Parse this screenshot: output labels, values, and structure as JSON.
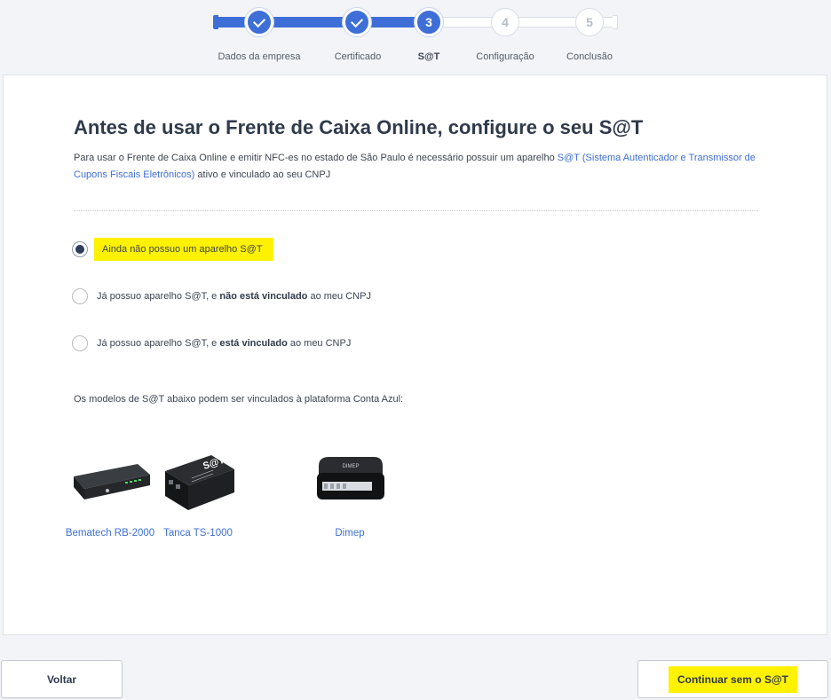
{
  "stepper": {
    "steps": [
      {
        "number": "1",
        "label": "Dados da empresa",
        "status": "done"
      },
      {
        "number": "2",
        "label": "Certificado",
        "status": "done"
      },
      {
        "number": "3",
        "label": "S@T",
        "status": "active"
      },
      {
        "number": "4",
        "label": "Configuração",
        "status": "todo"
      },
      {
        "number": "5",
        "label": "Conclusão",
        "status": "todo"
      }
    ]
  },
  "main": {
    "title": "Antes de usar o Frente de Caixa Online, configure o seu S@T",
    "intro_text": "Para usar o Frente de Caixa Online e emitir NFC-es no estado de São Paulo é necessário possuir um aparelho",
    "intro_link": "S@T (Sistema Autenticador e Transmissor de Cupons Fiscais Eletrônicos)",
    "intro_suffix": "ativo e vinculado ao seu CNPJ",
    "options": [
      {
        "label": "Ainda não possuo um aparelho S@T",
        "checked": true
      },
      {
        "prefix": "Já possuo aparelho S@T, e",
        "bold": "não está vinculado",
        "suffix": "ao meu CNPJ",
        "checked": false
      },
      {
        "prefix": "Já possuo aparelho S@T, e",
        "bold": "está vinculado",
        "suffix": "ao meu CNPJ",
        "checked": false
      }
    ],
    "models_text": "Os modelos de S@T abaixo podem ser vinculados à plataforma Conta Azul:",
    "products": [
      {
        "name": "Bematech RB-2000",
        "icon": "bematech-device-image"
      },
      {
        "name": "Tanca TS-1000",
        "icon": "tanca-device-image",
        "device_text": "S@T"
      },
      {
        "name": "Dimep",
        "icon": "dimep-device-image",
        "device_text": "DIMEP"
      }
    ]
  },
  "footer": {
    "back_label": "Voltar",
    "next_label": "Continuar sem o S@T"
  },
  "colors": {
    "accent": "#3e6fd7",
    "highlight": "#fff200",
    "background": "#f2f4f8"
  }
}
